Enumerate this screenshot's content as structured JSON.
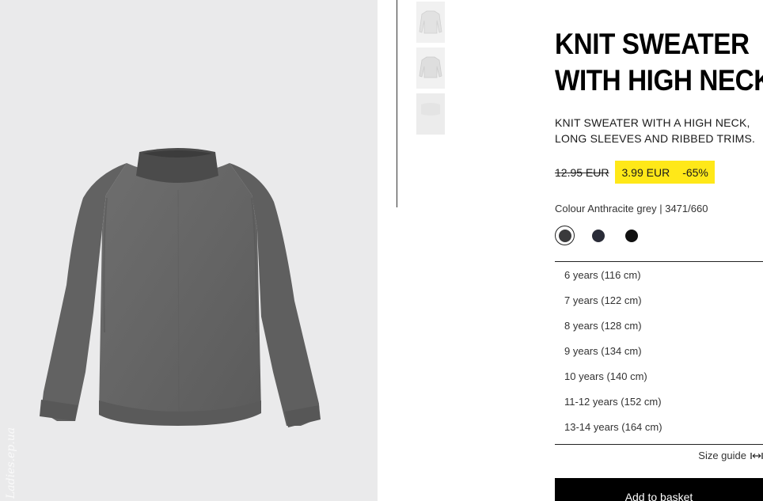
{
  "product": {
    "title_line1": "KNIT SWEATER",
    "title_line2": "WITH HIGH NECK",
    "description_line1": "KNIT SWEATER WITH A HIGH NECK,",
    "description_line2": "LONG SLEEVES AND RIBBED TRIMS.",
    "old_price": "12.95 EUR",
    "sale_price": "3.99 EUR",
    "discount": "-65%",
    "colour_text": "Colour Anthracite grey | 3471/660"
  },
  "colours": [
    {
      "name": "Anthracite grey",
      "hex": "#3a3a3c",
      "selected": true
    },
    {
      "name": "Navy",
      "hex": "#2a2c38",
      "selected": false
    },
    {
      "name": "Black",
      "hex": "#101010",
      "selected": false
    }
  ],
  "sizes": [
    "6 years (116 cm)",
    "7 years (122 cm)",
    "8 years (128 cm)",
    "9 years (134 cm)",
    "10 years (140 cm)",
    "11-12 years (152 cm)",
    "13-14 years (164 cm)"
  ],
  "actions": {
    "size_guide": "Size guide",
    "add_to_basket": "Add to basket"
  },
  "watermark": "Ladies.ep.ua",
  "colors": {
    "sale_highlight": "#ffe818",
    "button_bg": "#000000",
    "image_bg": "#eaeaeb"
  },
  "icons": {
    "size_guide": "ruler-arrows-icon"
  }
}
